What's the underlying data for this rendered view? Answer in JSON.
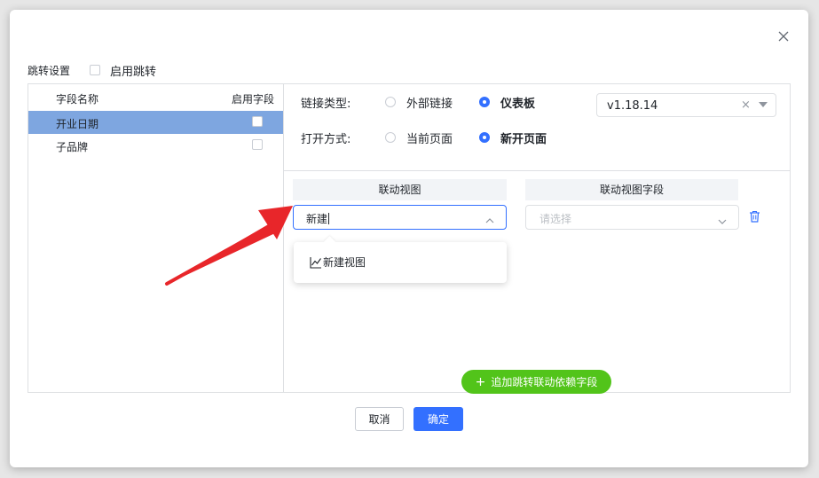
{
  "dialog": {
    "jump_settings_label": "跳转设置",
    "enable_jump_label": "启用跳转",
    "enable_jump_checked": false
  },
  "field_list": {
    "header_name": "字段名称",
    "header_enable": "启用字段",
    "rows": [
      {
        "name": "开业日期",
        "selected": true,
        "checked": false
      },
      {
        "name": "子品牌",
        "selected": false,
        "checked": false
      }
    ]
  },
  "link_config": {
    "link_type_label": "链接类型:",
    "link_type_options": [
      "外部链接",
      "仪表板"
    ],
    "link_type_selected": "仪表板",
    "open_mode_label": "打开方式:",
    "open_mode_options": [
      "当前页面",
      "新开页面"
    ],
    "open_mode_selected": "新开页面",
    "version_value": "v1.18.14",
    "version_clear": "×"
  },
  "linkage": {
    "col_view": "联动视图",
    "col_view_field": "联动视图字段",
    "view_input_value": "新建",
    "view_field_placeholder": "请选择",
    "dropdown_items": [
      "新建视图"
    ],
    "add_button_label": "追加跳转联动依赖字段",
    "add_button_plus": "+"
  },
  "footer": {
    "cancel_label": "取消",
    "ok_label": "确定"
  },
  "colors": {
    "primary": "#3370ff",
    "selected_row": "#7ea6e0",
    "add_button": "#52c41a",
    "annotation_arrow": "#e8262a"
  },
  "icons": [
    "close-icon",
    "chevron-up-icon",
    "chevron-down-icon",
    "trash-icon",
    "line-chart-icon",
    "caret-down-icon"
  ]
}
